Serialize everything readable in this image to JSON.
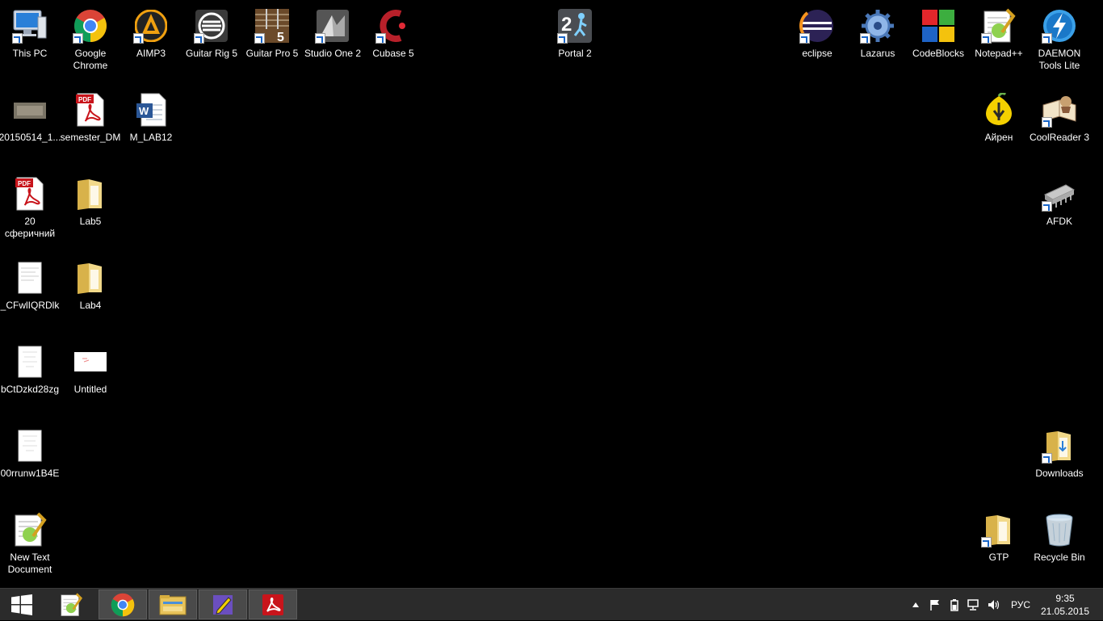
{
  "desktop": {
    "icons": {
      "this_pc": "This PC",
      "chrome": "Google Chrome",
      "aimp": "AIMP3",
      "guitar_rig": "Guitar Rig 5",
      "guitar_pro": "Guitar Pro 5",
      "studio_one": "Studio One 2",
      "cubase": "Cubase 5",
      "portal": "Portal 2",
      "eclipse": "eclipse",
      "lazarus": "Lazarus",
      "codeblocks": "CodeBlocks",
      "notepadpp": "Notepad++",
      "daemon": "DAEMON Tools Lite",
      "photo": "20150514_1...",
      "semester": "semester_DM",
      "mlab": "M_LAB12",
      "airen": "Айрен",
      "coolreader": "CoolReader 3",
      "pdf20": "20 сферичний",
      "lab5": "Lab5",
      "afdk": "AFDK",
      "cfw": "_CFwlIQRDlk",
      "lab4": "Lab4",
      "bct": "bCtDzkd28zg",
      "untitled": "Untitled",
      "rrunw": "00rrunw1B4E",
      "downloads": "Downloads",
      "newtext": "New Text Document",
      "gtp": "GTP",
      "recycle": "Recycle Bin"
    }
  },
  "taskbar": {
    "language": "РУС",
    "time": "9:35",
    "date": "21.05.2015"
  },
  "colors": {
    "taskbar": "#2b2b2b",
    "desktop": "#000000",
    "pdf_red": "#c8141b",
    "folder_yellow": "#e8c35a"
  }
}
